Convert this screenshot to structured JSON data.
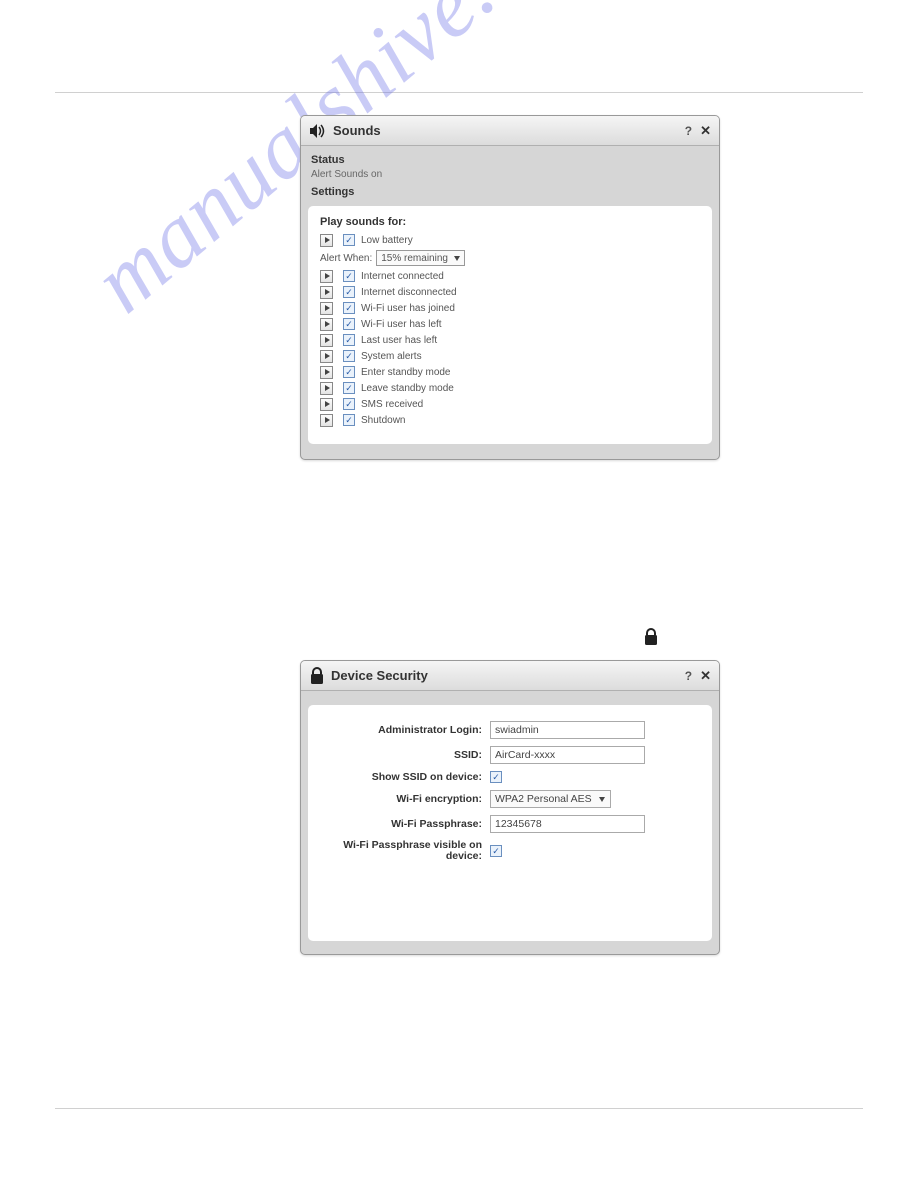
{
  "watermark": "manualshive.com",
  "sounds_panel": {
    "title": "Sounds",
    "status_label": "Status",
    "status_text": "Alert Sounds on",
    "settings_label": "Settings",
    "play_label": "Play sounds for:",
    "alert_when_label": "Alert When:",
    "alert_when_value": "15% remaining",
    "items": [
      "Low battery",
      "Internet connected",
      "Internet disconnected",
      "Wi-Fi user has joined",
      "Wi-Fi user has left",
      "Last user has left",
      "System alerts",
      "Enter standby mode",
      "Leave standby mode",
      "SMS received",
      "Shutdown"
    ]
  },
  "security_panel": {
    "title": "Device Security",
    "fields": {
      "admin_login_label": "Administrator Login:",
      "admin_login_value": "swiadmin",
      "ssid_label": "SSID:",
      "ssid_value": "AirCard-xxxx",
      "show_ssid_label": "Show SSID on device:",
      "encryption_label": "Wi-Fi encryption:",
      "encryption_value": "WPA2 Personal AES",
      "passphrase_label": "Wi-Fi Passphrase:",
      "passphrase_value": "12345678",
      "passphrase_visible_label_1": "Wi-Fi Passphrase visible on",
      "passphrase_visible_label_2": "device:"
    }
  }
}
